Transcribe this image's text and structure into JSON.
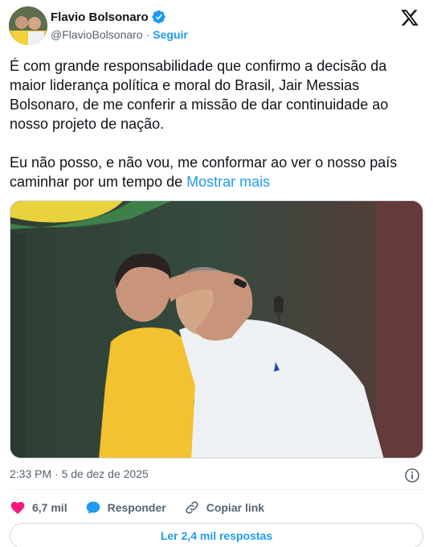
{
  "author": {
    "name": "Flavio Bolsonaro",
    "handle": "@FlavioBolsonaro",
    "separator": "·",
    "follow_label": "Seguir"
  },
  "tweet": {
    "text": "É com grande responsabilidade que confirmo a decisão da maior liderança política e moral do Brasil, Jair Messias Bolsonaro, de me conferir a missão de dar continuidade ao nosso projeto de nação.\n\nEu não posso, e não vou, me conformar ao ver o nosso país caminhar por um tempo de ",
    "show_more_label": "Mostrar mais"
  },
  "timestamp": "2:33 PM · 5 de dez de 2025",
  "actions": {
    "likes_count": "6,7 mil",
    "reply_label": "Responder",
    "copy_link_label": "Copiar link"
  },
  "replies_button_label": "Ler 2,4 mil respostas",
  "colors": {
    "accent": "#1d9bf0",
    "like": "#f91880",
    "text_secondary": "#536471"
  }
}
